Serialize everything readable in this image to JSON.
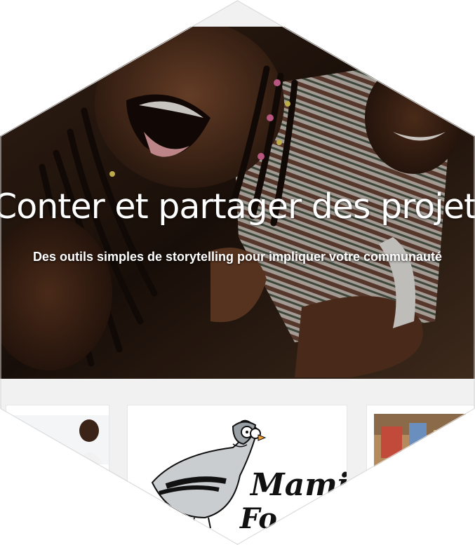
{
  "hero": {
    "title": "Conter et partager des projets",
    "subtitle": "Des outils simples de storytelling pour impliquer votre communauté",
    "overlay_color": "#000000"
  },
  "cards": {
    "left": {
      "image": "child-photo-thumbnail"
    },
    "center": {
      "logo": "pigeon-mascot-logo",
      "brand_line1": "Mami",
      "brand_line2": "Fo"
    },
    "right": {
      "image": "classroom-photo-thumbnail"
    }
  },
  "colors": {
    "background": "#f1f1f1",
    "card": "#ffffff",
    "text_hero": "#ffffff",
    "logo_ink": "#111111",
    "pigeon_body": "#c9cdd0",
    "pigeon_beak": "#f0a030"
  }
}
